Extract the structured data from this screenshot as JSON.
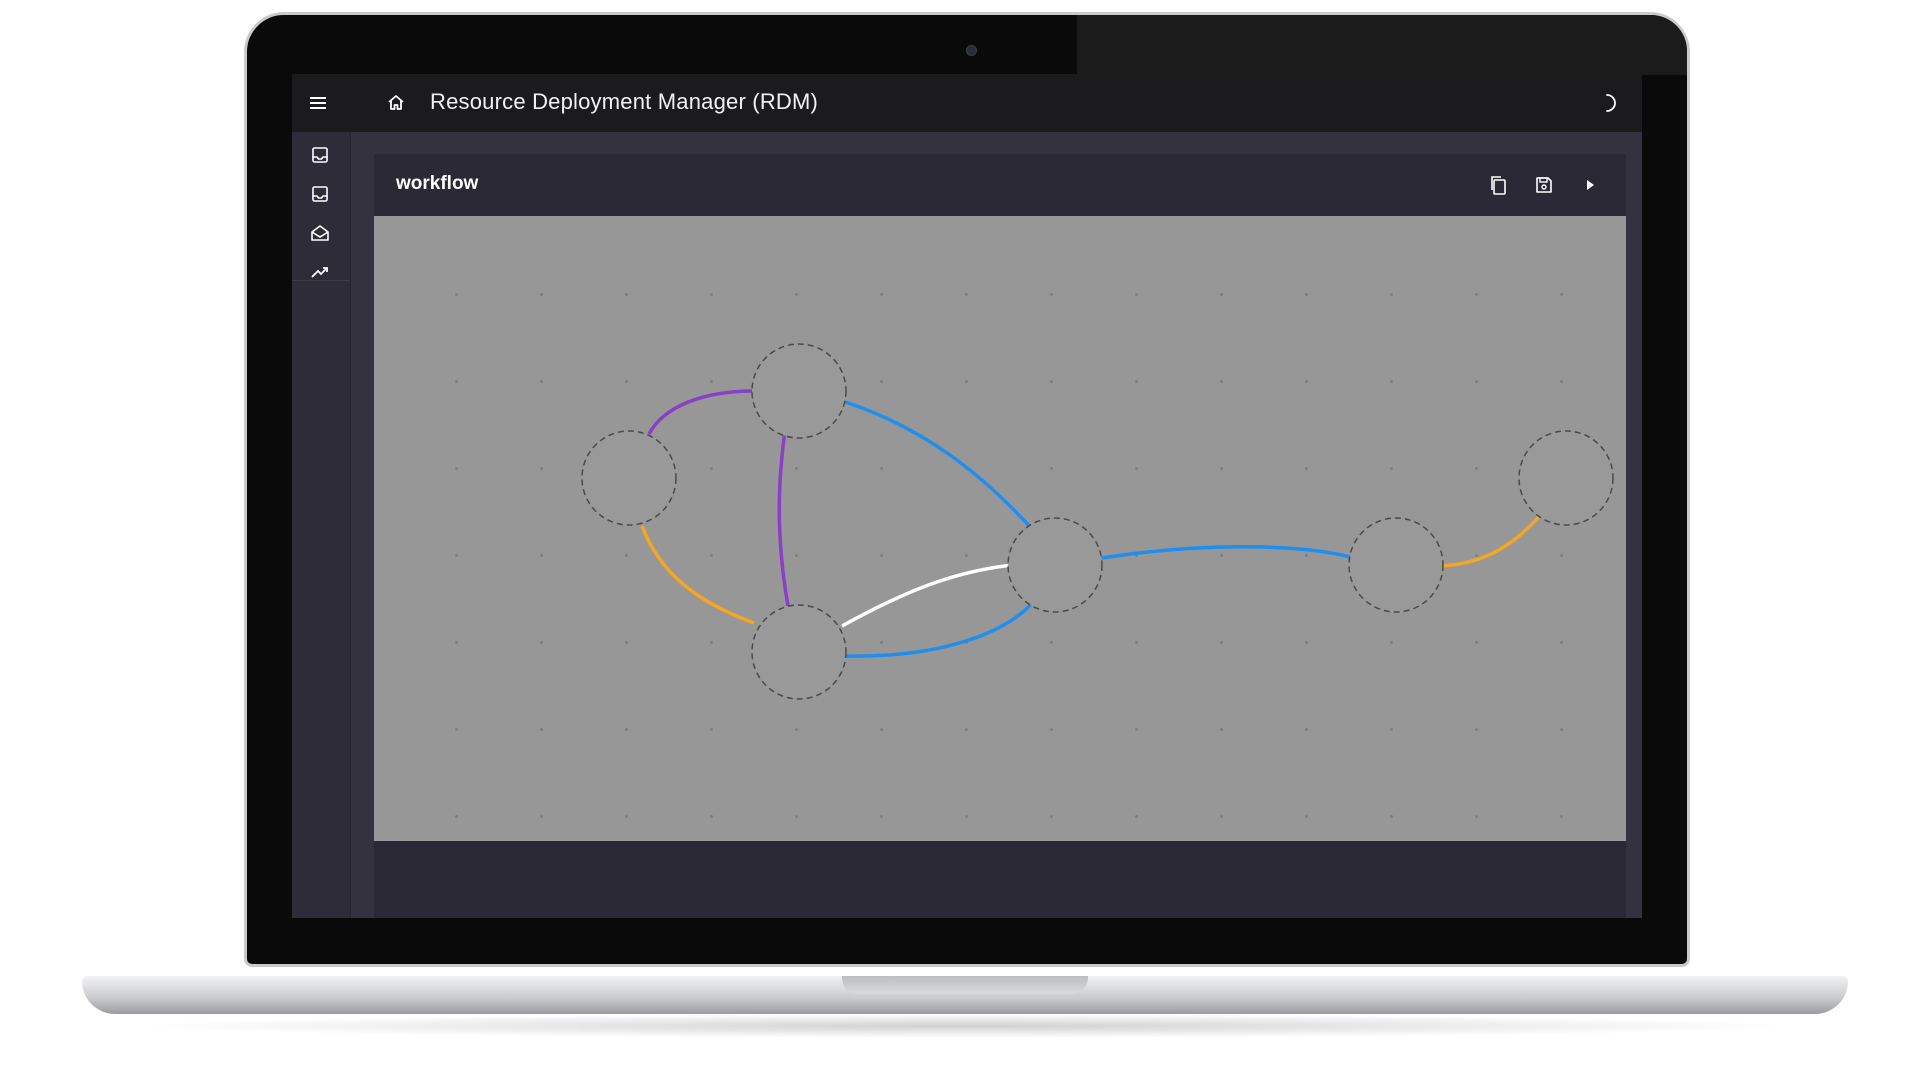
{
  "app": {
    "title": "Resource Deployment Manager (RDM)"
  },
  "icons": {
    "menu": "menu-icon",
    "home": "home-icon",
    "theme": "moon-icon",
    "sidebar": [
      "inbox-icon",
      "inbox-icon",
      "open-mail-icon",
      "trending-up-icon"
    ],
    "toolbar": [
      "copy-icon",
      "save-icon",
      "play-icon"
    ]
  },
  "panel": {
    "title": "workflow"
  },
  "graph": {
    "node_count": 6,
    "edge_colors": {
      "purple": "#8b3fc7",
      "blue": "#1f8fef",
      "orange": "#f5a623",
      "white": "#ffffff"
    }
  }
}
